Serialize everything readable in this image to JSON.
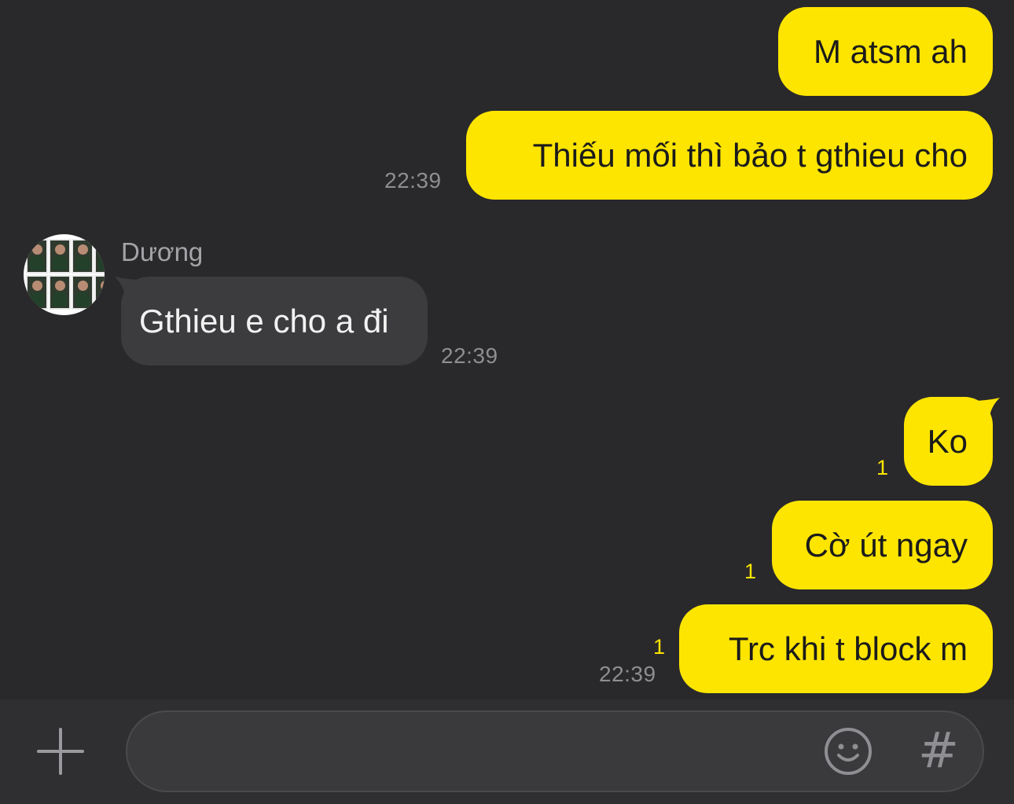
{
  "messages": [
    {
      "direction": "out",
      "text": "M atsm ah"
    },
    {
      "direction": "out",
      "text": "Thiếu mối thì bảo t gthieu cho",
      "time": "22:39"
    },
    {
      "direction": "in",
      "sender": "Dương",
      "text": "Gthieu e cho a đi",
      "time": "22:39"
    },
    {
      "direction": "out",
      "text": "Ko",
      "unread": "1"
    },
    {
      "direction": "out",
      "text": "Cờ út ngay",
      "unread": "1"
    },
    {
      "direction": "out",
      "text": "Trc khi t block m",
      "unread": "1",
      "time": "22:39"
    }
  ],
  "composer": {
    "placeholder": "",
    "plus_icon": "plus-icon",
    "emoji_icon": "smiley-icon",
    "hash_label": "#"
  },
  "colors": {
    "background": "#29292b",
    "outgoing_bubble": "#fee500",
    "incoming_bubble": "#3c3c3e",
    "timestamp": "#8e8e92",
    "unread_count": "#fee500"
  }
}
